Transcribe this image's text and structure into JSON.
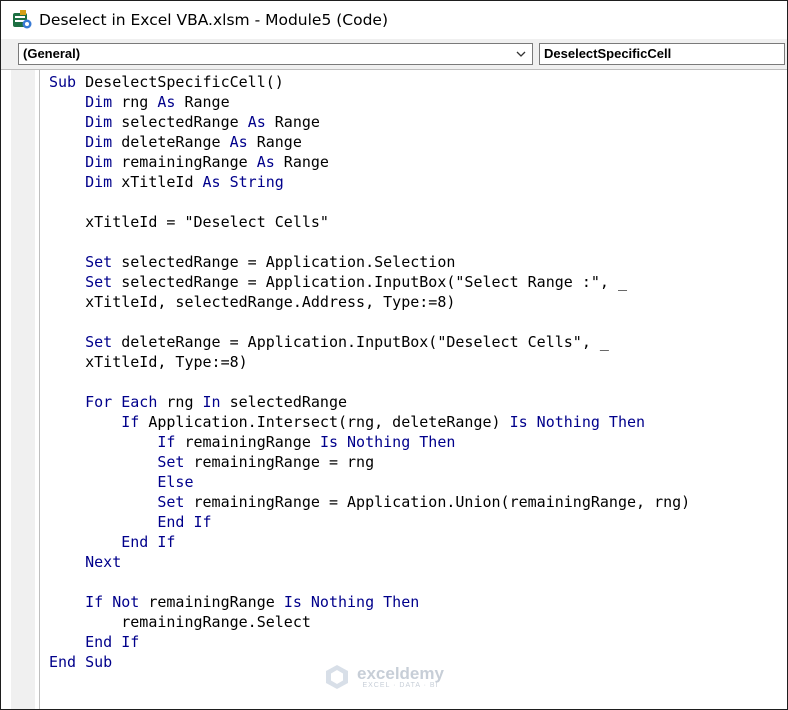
{
  "window": {
    "title": "Deselect in Excel VBA.xlsm - Module5 (Code)"
  },
  "combos": {
    "object": "(General)",
    "procedure": "DeselectSpecificCell"
  },
  "colors": {
    "keyword": "#00008b",
    "text": "#000000",
    "gutter": "#f0f0f0"
  },
  "code": {
    "lines": [
      [
        {
          "k": 1,
          "t": "Sub"
        },
        {
          "t": " DeselectSpecificCell()"
        }
      ],
      [
        {
          "t": "    "
        },
        {
          "k": 1,
          "t": "Dim"
        },
        {
          "t": " rng "
        },
        {
          "k": 1,
          "t": "As"
        },
        {
          "t": " Range"
        }
      ],
      [
        {
          "t": "    "
        },
        {
          "k": 1,
          "t": "Dim"
        },
        {
          "t": " selectedRange "
        },
        {
          "k": 1,
          "t": "As"
        },
        {
          "t": " Range"
        }
      ],
      [
        {
          "t": "    "
        },
        {
          "k": 1,
          "t": "Dim"
        },
        {
          "t": " deleteRange "
        },
        {
          "k": 1,
          "t": "As"
        },
        {
          "t": " Range"
        }
      ],
      [
        {
          "t": "    "
        },
        {
          "k": 1,
          "t": "Dim"
        },
        {
          "t": " remainingRange "
        },
        {
          "k": 1,
          "t": "As"
        },
        {
          "t": " Range"
        }
      ],
      [
        {
          "t": "    "
        },
        {
          "k": 1,
          "t": "Dim"
        },
        {
          "t": " xTitleId "
        },
        {
          "k": 1,
          "t": "As String"
        }
      ],
      [],
      [
        {
          "t": "    xTitleId = \"Deselect Cells\""
        }
      ],
      [],
      [
        {
          "t": "    "
        },
        {
          "k": 1,
          "t": "Set"
        },
        {
          "t": " selectedRange = Application.Selection"
        }
      ],
      [
        {
          "t": "    "
        },
        {
          "k": 1,
          "t": "Set"
        },
        {
          "t": " selectedRange = Application.InputBox(\"Select Range :\", _"
        }
      ],
      [
        {
          "t": "    xTitleId, selectedRange.Address, Type:=8)"
        }
      ],
      [],
      [
        {
          "t": "    "
        },
        {
          "k": 1,
          "t": "Set"
        },
        {
          "t": " deleteRange = Application.InputBox(\"Deselect Cells\", _"
        }
      ],
      [
        {
          "t": "    xTitleId, Type:=8)"
        }
      ],
      [],
      [
        {
          "t": "    "
        },
        {
          "k": 1,
          "t": "For Each"
        },
        {
          "t": " rng "
        },
        {
          "k": 1,
          "t": "In"
        },
        {
          "t": " selectedRange"
        }
      ],
      [
        {
          "t": "        "
        },
        {
          "k": 1,
          "t": "If"
        },
        {
          "t": " Application.Intersect(rng, deleteRange) "
        },
        {
          "k": 1,
          "t": "Is Nothing Then"
        }
      ],
      [
        {
          "t": "            "
        },
        {
          "k": 1,
          "t": "If"
        },
        {
          "t": " remainingRange "
        },
        {
          "k": 1,
          "t": "Is Nothing Then"
        }
      ],
      [
        {
          "t": "            "
        },
        {
          "k": 1,
          "t": "Set"
        },
        {
          "t": " remainingRange = rng"
        }
      ],
      [
        {
          "t": "            "
        },
        {
          "k": 1,
          "t": "Else"
        }
      ],
      [
        {
          "t": "            "
        },
        {
          "k": 1,
          "t": "Set"
        },
        {
          "t": " remainingRange = Application.Union(remainingRange, rng)"
        }
      ],
      [
        {
          "t": "            "
        },
        {
          "k": 1,
          "t": "End If"
        }
      ],
      [
        {
          "t": "        "
        },
        {
          "k": 1,
          "t": "End If"
        }
      ],
      [
        {
          "t": "    "
        },
        {
          "k": 1,
          "t": "Next"
        }
      ],
      [],
      [
        {
          "t": "    "
        },
        {
          "k": 1,
          "t": "If Not"
        },
        {
          "t": " remainingRange "
        },
        {
          "k": 1,
          "t": "Is Nothing Then"
        }
      ],
      [
        {
          "t": "        remainingRange.Select"
        }
      ],
      [
        {
          "t": "    "
        },
        {
          "k": 1,
          "t": "End If"
        }
      ],
      [
        {
          "k": 1,
          "t": "End Sub"
        }
      ]
    ]
  },
  "watermark": {
    "name": "exceldemy",
    "tagline": "EXCEL · DATA · BI"
  }
}
